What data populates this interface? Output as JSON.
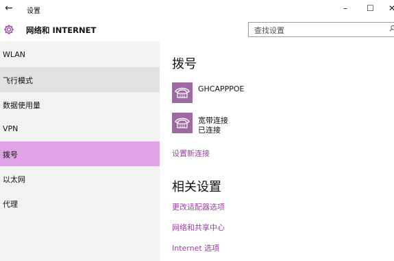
{
  "window": {
    "back_glyph": "←",
    "title": "设置",
    "minimize": "–",
    "maximize": "☐",
    "close": "✕"
  },
  "header": {
    "title": "网络和 INTERNET",
    "icon": "gear-icon",
    "search_placeholder": "查找设置",
    "search_icon": "search-icon"
  },
  "sidebar": {
    "items": [
      {
        "label": "WLAN",
        "state": "normal"
      },
      {
        "label": "飞行模式",
        "state": "hover"
      },
      {
        "label": "数据使用量",
        "state": "normal"
      },
      {
        "label": "VPN",
        "state": "normal"
      },
      {
        "label": "拨号",
        "state": "selected"
      },
      {
        "label": "以太网",
        "state": "normal"
      },
      {
        "label": "代理",
        "state": "normal"
      }
    ]
  },
  "main": {
    "title": "拨号",
    "connections": [
      {
        "name": "GHCAPPPOE",
        "status": "",
        "icon": "phone-icon"
      },
      {
        "name": "宽带连接",
        "status": "已连接",
        "icon": "phone-icon"
      }
    ],
    "setup_link": "设置新连接",
    "related_title": "相关设置",
    "related_links": [
      "更改适配器选项",
      "网络和共享中心",
      "Internet 选项"
    ]
  },
  "colors": {
    "accent": "#9b3fa3",
    "selected_bg": "#dfa3e5",
    "tile_bg": "#9f6aa3",
    "sidebar_bg": "#f2f2f2"
  }
}
